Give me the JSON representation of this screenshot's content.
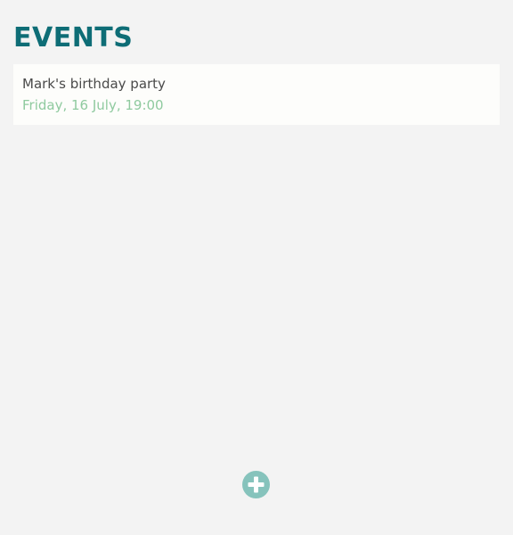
{
  "header": {
    "title": "EVENTS"
  },
  "events": [
    {
      "name": "Mark's birthday party",
      "date": "Friday, 16 July, 19:00"
    }
  ],
  "add_button": {
    "icon": "plus-circle-icon"
  },
  "colors": {
    "background": "#f3f3f3",
    "title": "#0e6d76",
    "card": "#fdfdfb",
    "event_name": "#4a4a4a",
    "event_date": "#8fca9f",
    "add_button": "#86c3bc"
  }
}
